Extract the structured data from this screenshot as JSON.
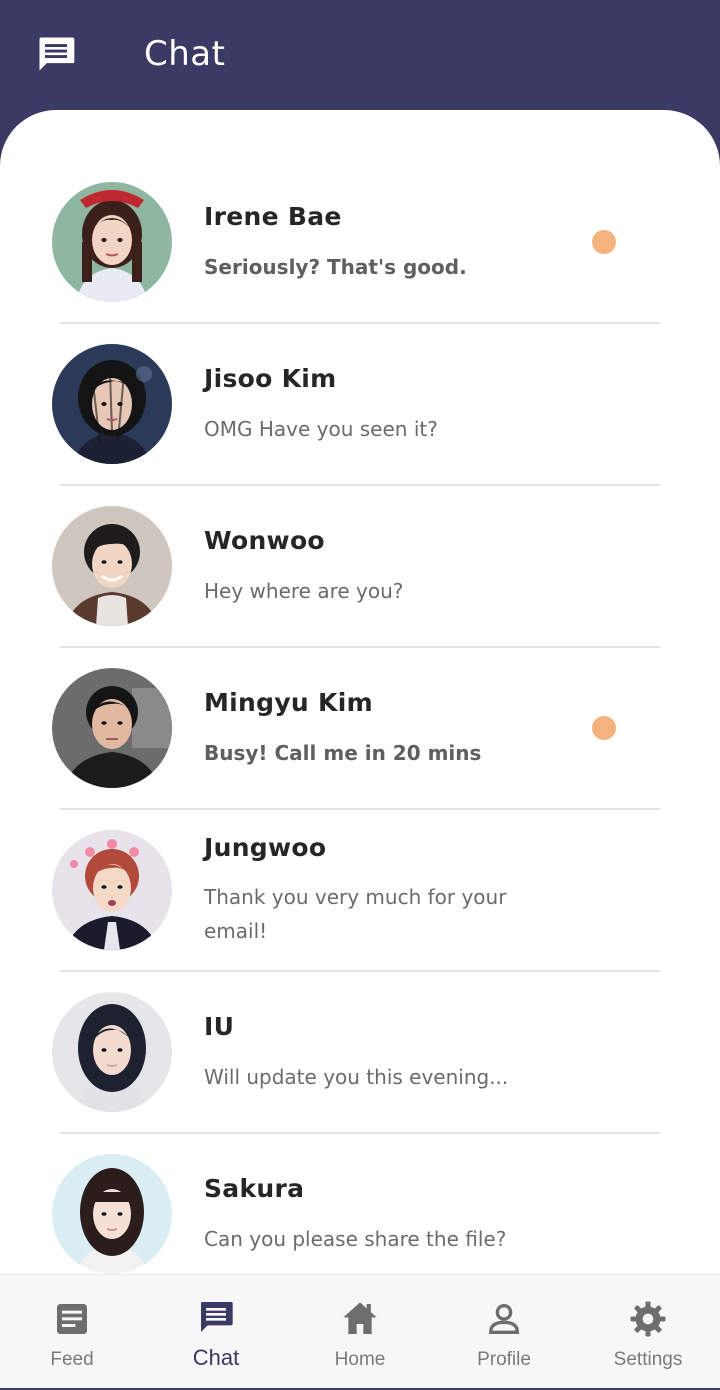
{
  "header": {
    "title": "Chat",
    "icon": "chat-bubble-icon"
  },
  "chats": [
    {
      "name": "Irene Bae",
      "message": "Seriously? That's good.",
      "unread": true,
      "avatar_colors": {
        "bg": "#8fb6a0",
        "hair": "#3a1f1a",
        "skin": "#f2d5c4",
        "top": "#e8eaf4",
        "accent": "#c0282f"
      }
    },
    {
      "name": "Jisoo Kim",
      "message": "OMG Have you seen it?",
      "unread": false,
      "avatar_colors": {
        "bg": "#2b3a58",
        "hair": "#141414",
        "skin": "#e7c8b6",
        "top": "#1b2035",
        "accent": "#5e6f96"
      }
    },
    {
      "name": "Wonwoo",
      "message": "Hey where are you?",
      "unread": false,
      "avatar_colors": {
        "bg": "#cfc7bf",
        "hair": "#1d1b1c",
        "skin": "#f1d6c3",
        "top": "#e8e4e0",
        "accent": "#5a3a2c"
      }
    },
    {
      "name": "Mingyu Kim",
      "message": "Busy! Call me in 20 mins",
      "unread": true,
      "avatar_colors": {
        "bg": "#6c6c6c",
        "hair": "#151515",
        "skin": "#e0b9a0",
        "top": "#1c1c1c",
        "accent": "#8a8a8a"
      }
    },
    {
      "name": "Jungwoo",
      "message": "Thank you very much for your email!",
      "unread": false,
      "avatar_colors": {
        "bg": "#e7e3ea",
        "hair": "#b24a3c",
        "skin": "#f4d8c8",
        "top": "#1b1b2b",
        "accent": "#f08aa6"
      }
    },
    {
      "name": "IU",
      "message": "Will update you this evening...",
      "unread": false,
      "avatar_colors": {
        "bg": "#e6e6e9",
        "hair": "#1e2230",
        "skin": "#f3dbd0",
        "top": "#e2e2e6",
        "accent": "#c6a49a"
      }
    },
    {
      "name": "Sakura",
      "message": "Can you please share the file?",
      "unread": false,
      "avatar_colors": {
        "bg": "#d9eef2",
        "hair": "#2a1d1c",
        "skin": "#f6e0d6",
        "top": "#f2f2f2",
        "accent": "#c98c8c"
      }
    }
  ],
  "bottom_nav": [
    {
      "label": "Feed",
      "icon": "feed-icon",
      "active": false
    },
    {
      "label": "Chat",
      "icon": "chat-icon",
      "active": true
    },
    {
      "label": "Home",
      "icon": "home-icon",
      "active": false
    },
    {
      "label": "Profile",
      "icon": "profile-icon",
      "active": false
    },
    {
      "label": "Settings",
      "icon": "settings-icon",
      "active": false
    }
  ],
  "colors": {
    "header_bg": "#3a3a64",
    "unread_dot": "#f3b27e",
    "nav_active": "#3a3a64",
    "nav_inactive": "#7a7a7a"
  }
}
